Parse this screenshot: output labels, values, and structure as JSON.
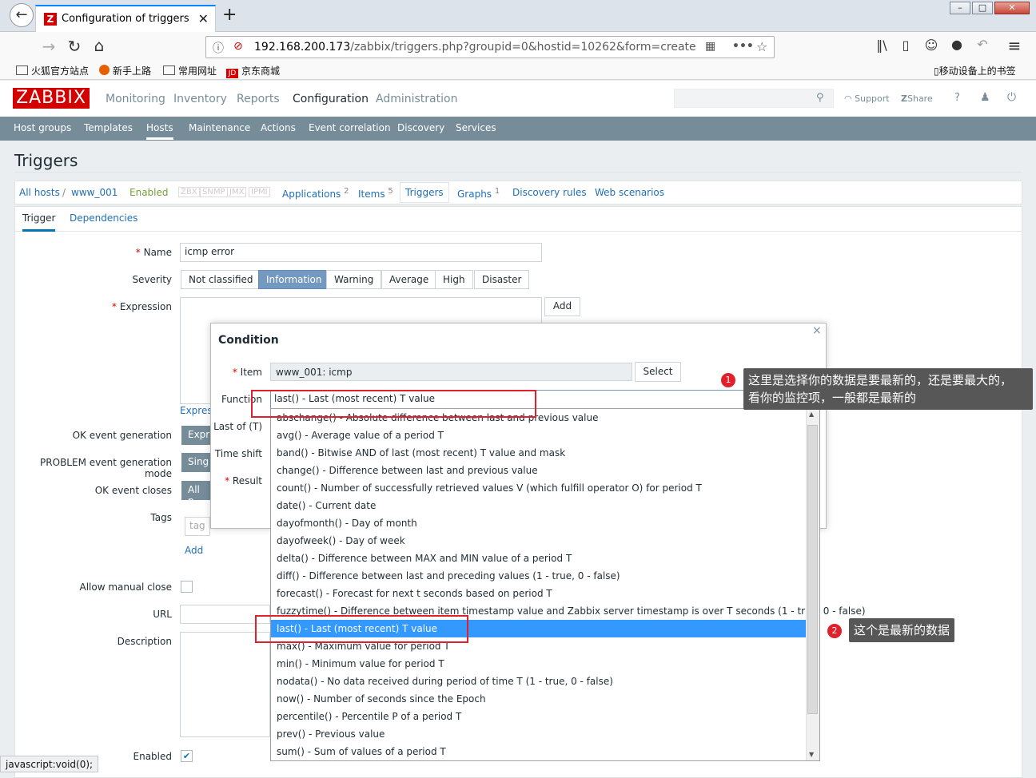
{
  "browser": {
    "tab_title": "Configuration of triggers",
    "url_host": "192.168.200.173",
    "url_path": "/zabbix/triggers.php?groupid=0&hostid=10262&form=create",
    "bookmarks": [
      "火狐官方站点",
      "新手上路",
      "常用网址",
      "京东商城"
    ],
    "mobile_bookmarks": "移动设备上的书签",
    "status_text": "javascript:void(0);"
  },
  "header": {
    "logo": "ZABBIX",
    "menu": [
      "Monitoring",
      "Inventory",
      "Reports",
      "Configuration",
      "Administration"
    ],
    "support": "Support",
    "share": "Share",
    "help": "?"
  },
  "subnav": [
    "Host groups",
    "Templates",
    "Hosts",
    "Maintenance",
    "Actions",
    "Event correlation",
    "Discovery",
    "Services"
  ],
  "page": {
    "title": "Triggers"
  },
  "breadcrumb": {
    "all_hosts": "All hosts",
    "sep": "/",
    "host": "www_001",
    "status": "Enabled",
    "avail": [
      "ZBX",
      "SNMP",
      "JMX",
      "IPMI"
    ],
    "applications": "Applications",
    "applications_count": "2",
    "items": "Items",
    "items_count": "5",
    "triggers": "Triggers",
    "graphs": "Graphs",
    "graphs_count": "1",
    "discovery_rules": "Discovery rules",
    "web_scenarios": "Web scenarios"
  },
  "form": {
    "tabs": [
      "Trigger",
      "Dependencies"
    ],
    "name_label": "Name",
    "name_value": "icmp error",
    "severity_label": "Severity",
    "severities": [
      "Not classified",
      "Information",
      "Warning",
      "Average",
      "High",
      "Disaster"
    ],
    "expression_label": "Expression",
    "add_btn": "Add",
    "expression_constructor": "Expres",
    "ok_event_generation": "OK event generation",
    "ok_event_generation_val": "Expr",
    "problem_event_mode": "PROBLEM event generation mode",
    "problem_event_mode_val": "Sing",
    "ok_event_closes": "OK event closes",
    "ok_event_closes_val": "All p",
    "tags_label": "Tags",
    "tag_placeholder": "tag",
    "tags_add": "Add",
    "allow_manual_close": "Allow manual close",
    "url_label": "URL",
    "description_label": "Description",
    "enabled_label": "Enabled"
  },
  "dialog": {
    "title": "Condition",
    "close": "×",
    "item_label": "Item",
    "item_value": "www_001: icmp",
    "select_btn": "Select",
    "function_label": "Function",
    "function_value": "last() - Last (most recent) T value",
    "last_of_label": "Last of (T)",
    "time_shift_label": "Time shift",
    "result_label": "Result",
    "options": [
      "abschange() - Absolute difference between last and previous value",
      "avg() - Average value of a period T",
      "band() - Bitwise AND of last (most recent) T value and mask",
      "change() - Difference between last and previous value",
      "count() - Number of successfully retrieved values V (which fulfill operator O) for period T",
      "date() - Current date",
      "dayofmonth() - Day of month",
      "dayofweek() - Day of week",
      "delta() - Difference between MAX and MIN value of a period T",
      "diff() - Difference between last and preceding values (1 - true, 0 - false)",
      "forecast() - Forecast for next t seconds based on period T",
      "fuzzytime() - Difference between item timestamp value and Zabbix server timestamp is over T seconds (1 - true, 0 - false)",
      "last() - Last (most recent) T value",
      "max() - Maximum value for period T",
      "min() - Minimum value for period T",
      "nodata() - No data received during period of time T (1 - true, 0 - false)",
      "now() - Number of seconds since the Epoch",
      "percentile() - Percentile P of a period T",
      "prev() - Previous value",
      "sum() - Sum of values of a period T"
    ],
    "selected_index": 12
  },
  "annotations": {
    "n1": "1",
    "note1_line1": "这里是选择你的数据是要最新的，还是要最大的，",
    "note1_line2": "看你的监控项，一般都是最新的",
    "n2": "2",
    "note2": "这个是最新的数据"
  },
  "colors": {
    "brand": "#d40000",
    "subnav": "#768d99",
    "severity_active": "#7499c0",
    "selection": "#3399ff",
    "annotation_box": "#e0202a"
  }
}
